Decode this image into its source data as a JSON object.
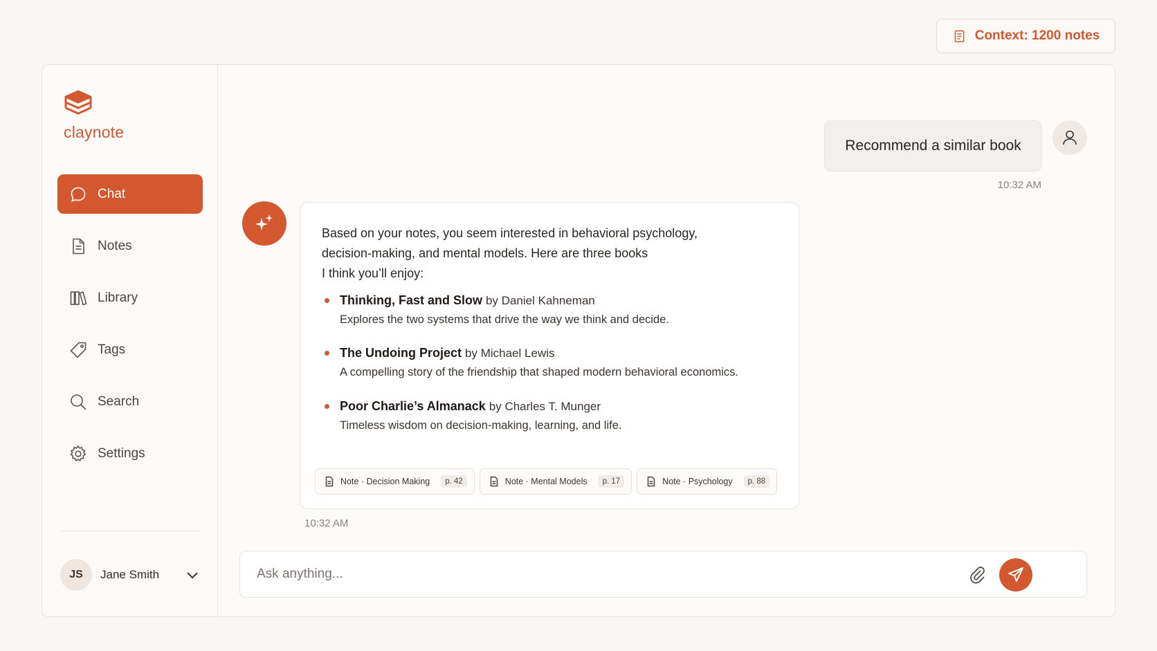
{
  "header": {
    "context_label": "Context: 1200 notes"
  },
  "brand": {
    "name": "claynote",
    "accent": "#d4582f"
  },
  "sidebar": {
    "items": [
      {
        "label": "Chat",
        "icon": "chat-bubble-icon",
        "active": true
      },
      {
        "label": "Notes",
        "icon": "document-icon"
      },
      {
        "label": "Library",
        "icon": "library-icon"
      },
      {
        "label": "Tags",
        "icon": "tag-icon"
      },
      {
        "label": "Search",
        "icon": "search-icon"
      },
      {
        "label": "Settings",
        "icon": "gear-icon"
      }
    ],
    "user": {
      "initials": "JS",
      "name": "Jane Smith"
    }
  },
  "chat": {
    "user_message": {
      "text": "Recommend a similar book",
      "time": "10:32 AM"
    },
    "ai_message": {
      "intro": [
        "Based on your notes, you seem interested in behavioral psychology,",
        "decision-making, and mental models. Here are three books",
        "I think you’ll enjoy:"
      ],
      "books": [
        {
          "title": "Thinking, Fast and Slow",
          "author": "by Daniel Kahneman",
          "desc": "Explores the two systems that drive the way we think and decide."
        },
        {
          "title": "The Undoing Project",
          "author": "by Michael Lewis",
          "desc": "A compelling story of the friendship that shaped modern behavioral economics."
        },
        {
          "title": "Poor Charlie’s Almanack",
          "author": "by Charles T. Munger",
          "desc": "Timeless wisdom on decision-making, learning, and life."
        }
      ],
      "sources": [
        {
          "label": "Note · Decision Making",
          "page": "p. 42"
        },
        {
          "label": "Note · Mental Models",
          "page": "p. 17"
        },
        {
          "label": "Note · Psychology",
          "page": "p. 88"
        }
      ],
      "time": "10:32 AM"
    }
  },
  "composer": {
    "placeholder": "Ask anything..."
  }
}
